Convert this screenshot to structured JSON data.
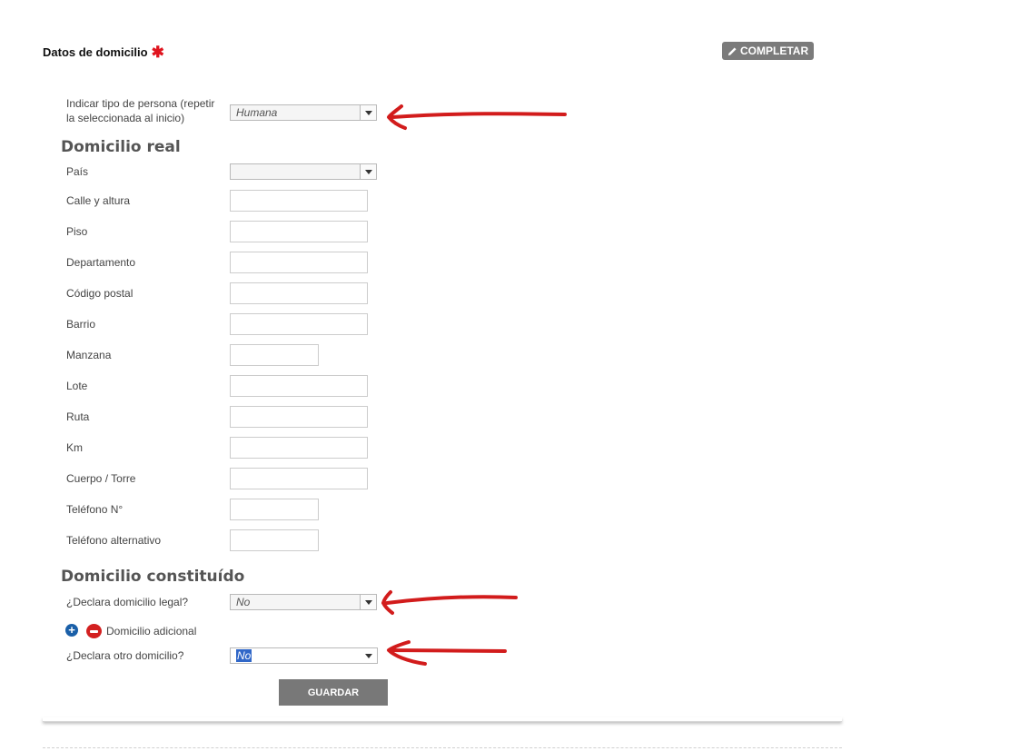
{
  "header": {
    "title": "Datos de domicilio",
    "required_mark": "✱",
    "completar_button": "COMPLETAR"
  },
  "persona": {
    "label": "Indicar tipo de persona (repetir la seleccionada al inicio)",
    "selected": "Humana"
  },
  "domicilio_real": {
    "heading": "Domicilio real",
    "pais_label": "País",
    "pais_value": "",
    "fields": {
      "calle": "Calle y altura",
      "piso": "Piso",
      "departamento": "Departamento",
      "codigo_postal": "Código postal",
      "barrio": "Barrio",
      "manzana": "Manzana",
      "lote": "Lote",
      "ruta": "Ruta",
      "km": "Km",
      "cuerpo_torre": "Cuerpo / Torre",
      "telefono": "Teléfono N°",
      "telefono_alt": "Teléfono alternativo"
    }
  },
  "domicilio_constituido": {
    "heading": "Domicilio constituído",
    "legal_label": "¿Declara domicilio legal?",
    "legal_selected": "No",
    "adicional_label": "Domicilio adicional",
    "otro_label": "¿Declara otro domicilio?",
    "otro_selected": "No"
  },
  "actions": {
    "guardar": "GUARDAR"
  },
  "colors": {
    "annotation_red": "#d21c1c",
    "required": "#e0141e",
    "button_gray": "#787878"
  }
}
